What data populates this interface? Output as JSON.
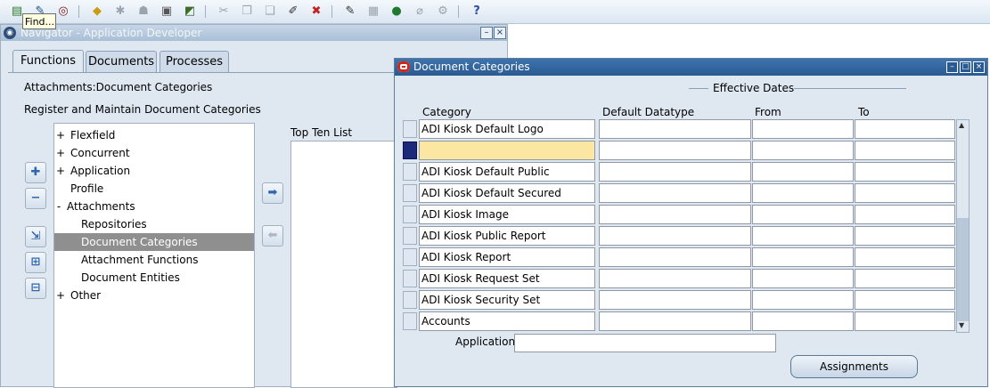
{
  "toolbar": {
    "icons": [
      "new-record-icon",
      "find-icon",
      "navigator-icon",
      "save-icon",
      "next-step-icon",
      "switch-responsibility-icon",
      "print-icon",
      "close-form-icon",
      "cut-icon",
      "copy-icon",
      "paste-icon",
      "clear-record-icon",
      "delete-record-icon",
      "edit-field-icon",
      "zoom-icon",
      "translations-icon",
      "attachments-icon",
      "folder-tools-icon",
      "help-icon"
    ],
    "tooltip": "Find..."
  },
  "navigator": {
    "title": "Navigator - Application Developer",
    "tabs": [
      {
        "label": "Functions",
        "active": true
      },
      {
        "label": "Documents",
        "active": false
      },
      {
        "label": "Processes",
        "active": false
      }
    ],
    "path_text": "Attachments:Document Categories",
    "description": "Register and Maintain Document Categories",
    "tree": [
      {
        "marker": "+",
        "label": "Flexfield",
        "level": 0
      },
      {
        "marker": "+",
        "label": "Concurrent",
        "level": 0
      },
      {
        "marker": "+",
        "label": "Application",
        "level": 0
      },
      {
        "marker": "",
        "label": "Profile",
        "level": 0
      },
      {
        "marker": "-",
        "label": "Attachments",
        "level": 0
      },
      {
        "marker": "",
        "label": "Repositories",
        "level": 1
      },
      {
        "marker": "",
        "label": "Document Categories",
        "level": 1,
        "selected": true
      },
      {
        "marker": "",
        "label": "Attachment Functions",
        "level": 1
      },
      {
        "marker": "",
        "label": "Document Entities",
        "level": 1
      },
      {
        "marker": "+",
        "label": "Other",
        "level": 0
      }
    ],
    "top_ten_label": "Top Ten List"
  },
  "doc_categories": {
    "title": "Document Categories",
    "effective_dates_label": "Effective Dates",
    "columns": {
      "category": "Category",
      "datatype": "Default Datatype",
      "from": "From",
      "to": "To"
    },
    "rows": [
      {
        "category": "ADI Kiosk Default Logo",
        "datatype": "",
        "from": "",
        "to": "",
        "current": false
      },
      {
        "category": "",
        "datatype": "",
        "from": "",
        "to": "",
        "current": true
      },
      {
        "category": "ADI Kiosk Default Public",
        "datatype": "",
        "from": "",
        "to": "",
        "current": false
      },
      {
        "category": "ADI Kiosk Default Secured",
        "datatype": "",
        "from": "",
        "to": "",
        "current": false
      },
      {
        "category": "ADI Kiosk Image",
        "datatype": "",
        "from": "",
        "to": "",
        "current": false
      },
      {
        "category": "ADI Kiosk Public Report",
        "datatype": "",
        "from": "",
        "to": "",
        "current": false
      },
      {
        "category": "ADI Kiosk Report",
        "datatype": "",
        "from": "",
        "to": "",
        "current": false
      },
      {
        "category": "ADI Kiosk Request Set",
        "datatype": "",
        "from": "",
        "to": "",
        "current": false
      },
      {
        "category": "ADI Kiosk Security Set",
        "datatype": "",
        "from": "",
        "to": "",
        "current": false
      },
      {
        "category": "Accounts",
        "datatype": "",
        "from": "",
        "to": "",
        "current": false
      }
    ],
    "application_label": "Application",
    "application_value": "",
    "assignments_label": "Assignments"
  }
}
